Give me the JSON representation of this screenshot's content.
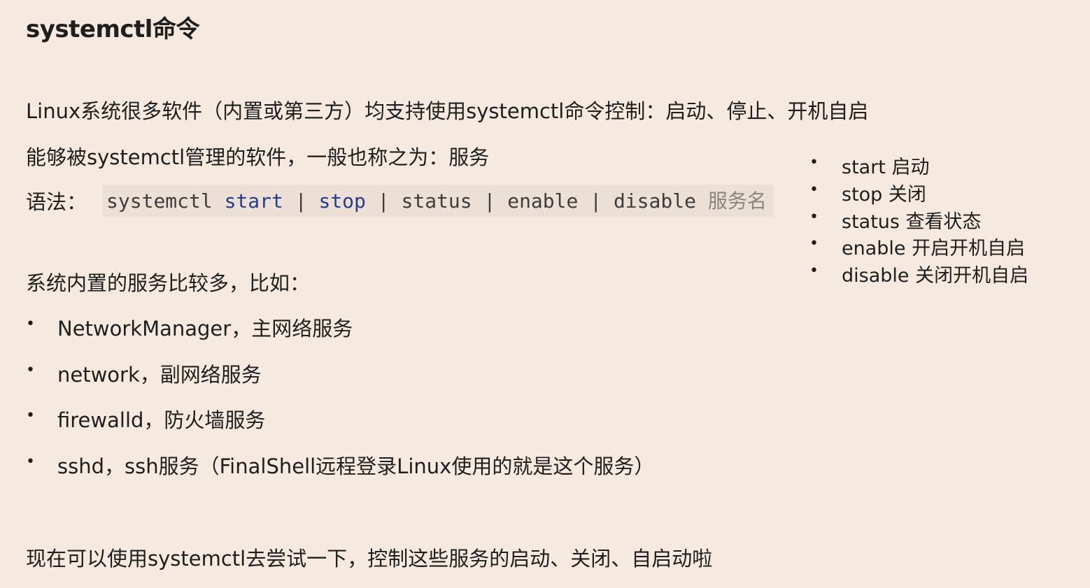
{
  "title": "systemctl命令",
  "intro": "Linux系统很多软件（内置或第三方）均支持使用systemctl命令控制：启动、停止、开机自启",
  "managed_note": "能够被systemctl管理的软件，一般也称之为：服务",
  "syntax": {
    "label": "语法：",
    "command": "systemctl",
    "sep": " | ",
    "start": "start",
    "stop": "stop",
    "status": "status",
    "enable": "enable",
    "disable": "disable",
    "placeholder": "服务名"
  },
  "builtin_intro": "系统内置的服务比较多，比如：",
  "bullet_glyph": "•",
  "services": [
    "NetworkManager，主网络服务",
    "network，副网络服务",
    "firewalld，防火墙服务",
    "sshd，ssh服务（FinalShell远程登录Linux使用的就是这个服务）"
  ],
  "commands": [
    "start 启动",
    "stop 关闭",
    "status 查看状态",
    "enable 开启开机自启",
    "disable 关闭开机自启"
  ],
  "outro": "现在可以使用systemctl去尝试一下，控制这些服务的启动、关闭、自启动啦",
  "colors": {
    "background": "#f5e9e0",
    "code_background": "#ece0d6",
    "keyword": "#283c8c",
    "text": "#1e1e1e"
  }
}
